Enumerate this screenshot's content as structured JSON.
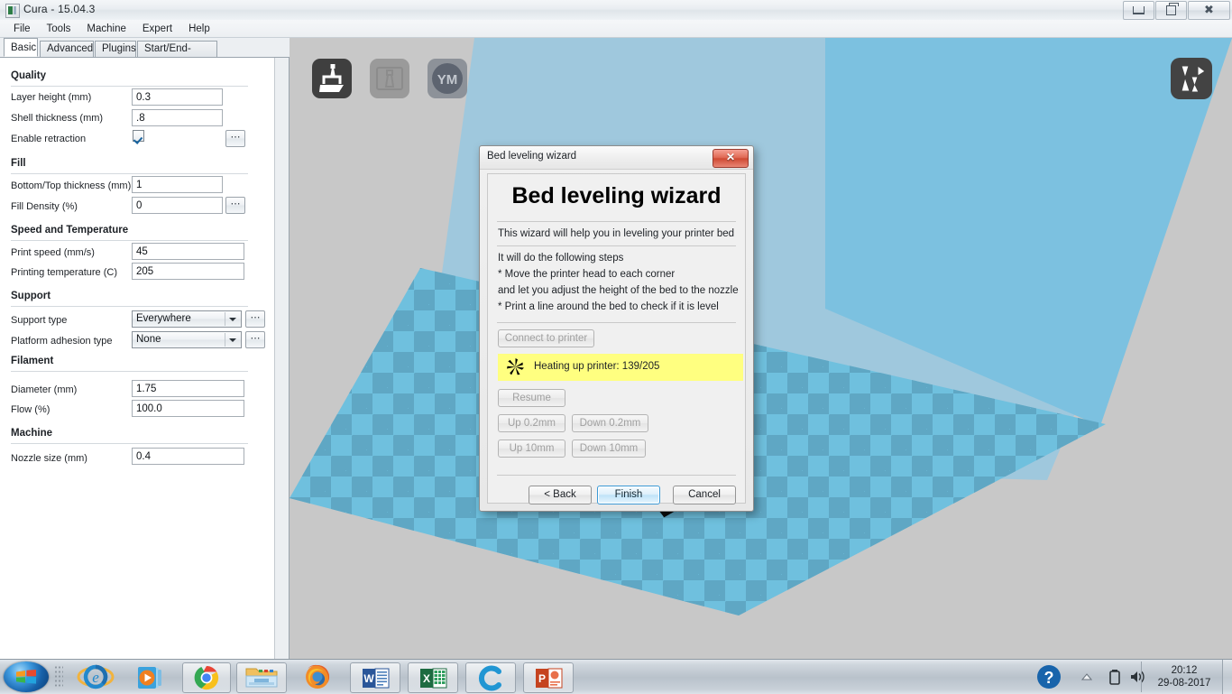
{
  "window": {
    "title": "Cura - 15.04.3",
    "icon": "cura-app-icon",
    "buttons": {
      "minimize": "minimize",
      "maximize": "restore",
      "close": "close"
    }
  },
  "menu": {
    "items": [
      "File",
      "Tools",
      "Machine",
      "Expert",
      "Help"
    ]
  },
  "tabs": {
    "items": [
      "Basic",
      "Advanced",
      "Plugins",
      "Start/End-GCode"
    ],
    "active": "Basic"
  },
  "settings": {
    "groups": [
      {
        "title": "Quality",
        "fields": [
          {
            "label": "Layer height (mm)",
            "type": "text",
            "value": "0.3",
            "dots": false
          },
          {
            "label": "Shell thickness (mm)",
            "type": "text",
            "value": ".8",
            "dots": false
          },
          {
            "label": "Enable retraction",
            "type": "checkbox",
            "value": "checked",
            "dots": true
          }
        ]
      },
      {
        "title": "Fill",
        "fields": [
          {
            "label": "Bottom/Top thickness (mm)",
            "type": "text",
            "value": "1",
            "dots": false
          },
          {
            "label": "Fill Density (%)",
            "type": "text",
            "value": "0",
            "dots": true
          }
        ]
      },
      {
        "title": "Speed and Temperature",
        "fields": [
          {
            "label": "Print speed (mm/s)",
            "type": "text",
            "value": "45",
            "dots": false
          },
          {
            "label": "Printing temperature (C)",
            "type": "text",
            "value": "205",
            "dots": false
          }
        ]
      },
      {
        "title": "Support",
        "fields": [
          {
            "label": "Support type",
            "type": "select",
            "value": "Everywhere",
            "dots": true
          },
          {
            "label": "Platform adhesion type",
            "type": "select",
            "value": "None",
            "dots": true
          }
        ]
      },
      {
        "title": "Filament",
        "fields": [
          {
            "label": "Diameter (mm)",
            "type": "text",
            "value": "1.75",
            "dots": false
          },
          {
            "label": "Flow (%)",
            "type": "text",
            "value": "100.0",
            "dots": false
          }
        ]
      },
      {
        "title": "Machine",
        "fields": [
          {
            "label": "Nozzle size (mm)",
            "type": "text",
            "value": "0.4",
            "dots": false
          }
        ]
      }
    ]
  },
  "viewport": {
    "tools": [
      {
        "name": "load-model-icon",
        "label": "Load"
      },
      {
        "name": "print-model-icon",
        "label": "Print"
      },
      {
        "name": "youmagine-icon",
        "label": "YM"
      }
    ],
    "view_mode_icon": "view-mode-icon",
    "colors": {
      "background": "#c8c8c8",
      "wall_left": "#9fc8dd",
      "wall_right": "#7cc1e0",
      "bed_light": "#6fc0de",
      "bed_dark": "#5fa7c4"
    }
  },
  "dialog": {
    "titlebar": "Bed leveling wizard",
    "close_label": "✕",
    "heading": "Bed leveling wizard",
    "subtitle": "This wizard will help you in leveling your printer bed",
    "steps": [
      "It will do the following steps",
      "* Move the printer head to each corner",
      "  and let you adjust the height of the bed to the nozzle",
      "* Print a line around the bed to check if it is level"
    ],
    "connect_button": "Connect to printer",
    "status": {
      "text": "Heating up printer: 139/205",
      "current_temp": 139,
      "target_temp": 205,
      "background": "#ffff80",
      "icon": "busy-spinner-icon"
    },
    "resume_button": "Resume",
    "jog_buttons": [
      [
        "Up 0.2mm",
        "Down 0.2mm"
      ],
      [
        "Up 10mm",
        "Down 10mm"
      ]
    ],
    "nav_buttons": [
      {
        "label": "< Back",
        "primary": false
      },
      {
        "label": "Finish",
        "primary": true
      },
      {
        "label": "Cancel",
        "primary": false
      }
    ]
  },
  "taskbar": {
    "start": "start-orb",
    "items": [
      {
        "name": "taskbar-internet-explorer",
        "icon": "internet-explorer-icon",
        "framed": false
      },
      {
        "name": "taskbar-windows-media-player",
        "icon": "media-player-icon",
        "framed": false
      },
      {
        "name": "taskbar-google-chrome",
        "icon": "chrome-icon",
        "framed": true
      },
      {
        "name": "taskbar-file-explorer",
        "icon": "explorer-folder-icon",
        "framed": true
      },
      {
        "name": "taskbar-firefox",
        "icon": "firefox-icon",
        "framed": false
      },
      {
        "name": "taskbar-word",
        "icon": "word-icon",
        "framed": true
      },
      {
        "name": "taskbar-excel",
        "icon": "excel-icon",
        "framed": true
      },
      {
        "name": "taskbar-cura",
        "icon": "cura-icon",
        "framed": true
      },
      {
        "name": "taskbar-powerpoint",
        "icon": "powerpoint-icon",
        "framed": true
      }
    ],
    "tray": {
      "help": "help-icon",
      "show_hidden": "show-hidden-icons-arrow",
      "battery": "battery-icon",
      "volume": "volume-icon"
    },
    "clock": {
      "time": "20:12",
      "date": "29-08-2017"
    }
  }
}
